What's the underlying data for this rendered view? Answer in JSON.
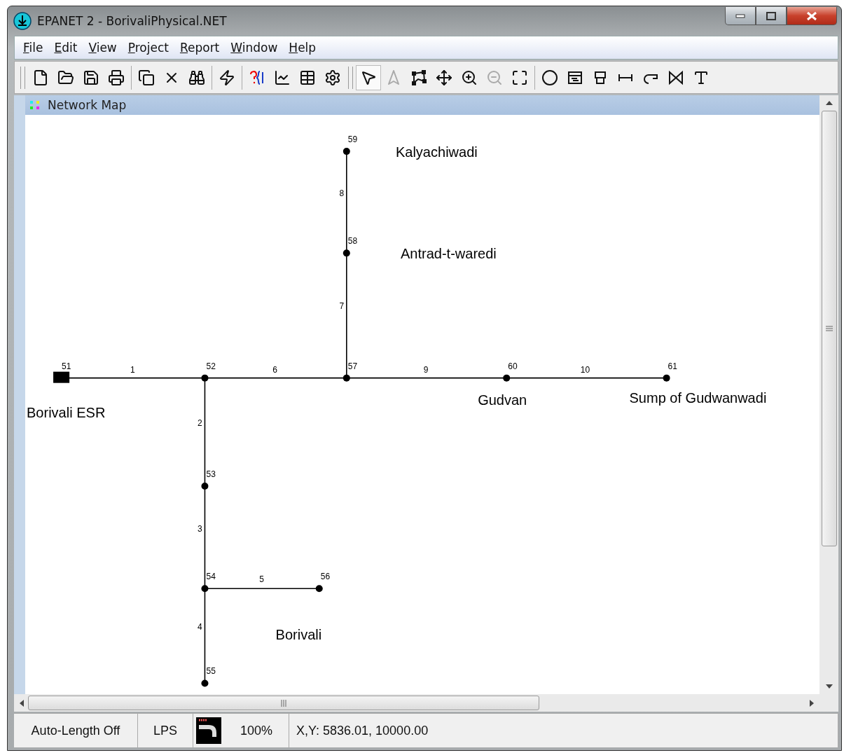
{
  "window": {
    "title": "EPANET 2 - BorivaliPhysical.NET"
  },
  "menu": [
    "File",
    "Edit",
    "View",
    "Project",
    "Report",
    "Window",
    "Help"
  ],
  "toolbar_groups": [
    [
      {
        "kind": "new",
        "selected": false,
        "disabled": false
      },
      {
        "kind": "open",
        "selected": false,
        "disabled": false
      },
      {
        "kind": "save",
        "selected": false,
        "disabled": false
      },
      {
        "kind": "print",
        "selected": false,
        "disabled": false
      }
    ],
    [
      {
        "kind": "copy",
        "selected": false,
        "disabled": false
      },
      {
        "kind": "delete",
        "selected": false,
        "disabled": false
      },
      {
        "kind": "find",
        "selected": false,
        "disabled": false
      }
    ],
    [
      {
        "kind": "run",
        "selected": false,
        "disabled": false
      }
    ],
    [
      {
        "kind": "query",
        "selected": false,
        "disabled": false
      },
      {
        "kind": "graph",
        "selected": false,
        "disabled": false
      },
      {
        "kind": "table",
        "selected": false,
        "disabled": false
      },
      {
        "kind": "options",
        "selected": false,
        "disabled": false
      }
    ],
    [
      {
        "kind": "select",
        "selected": true,
        "disabled": false
      },
      {
        "kind": "vertex",
        "selected": false,
        "disabled": true
      },
      {
        "kind": "region",
        "selected": false,
        "disabled": false
      },
      {
        "kind": "pan",
        "selected": false,
        "disabled": false
      },
      {
        "kind": "zoomin",
        "selected": false,
        "disabled": false
      },
      {
        "kind": "zoomout",
        "selected": false,
        "disabled": true
      },
      {
        "kind": "extent",
        "selected": false,
        "disabled": false
      }
    ],
    [
      {
        "kind": "junction",
        "selected": false,
        "disabled": false
      },
      {
        "kind": "reservoir",
        "selected": false,
        "disabled": false
      },
      {
        "kind": "tank",
        "selected": false,
        "disabled": false
      },
      {
        "kind": "pipe",
        "selected": false,
        "disabled": false
      },
      {
        "kind": "pump",
        "selected": false,
        "disabled": false
      },
      {
        "kind": "valve",
        "selected": false,
        "disabled": false
      },
      {
        "kind": "label",
        "selected": false,
        "disabled": false
      }
    ]
  ],
  "map_window": {
    "title": "Network Map",
    "nodes": [
      {
        "id": "59",
        "kind": "junction"
      },
      {
        "id": "58",
        "kind": "junction"
      },
      {
        "id": "51",
        "kind": "tank"
      },
      {
        "id": "52",
        "kind": "junction"
      },
      {
        "id": "57",
        "kind": "junction"
      },
      {
        "id": "60",
        "kind": "junction"
      },
      {
        "id": "61",
        "kind": "junction"
      },
      {
        "id": "53",
        "kind": "junction"
      },
      {
        "id": "54",
        "kind": "junction"
      },
      {
        "id": "56",
        "kind": "junction"
      },
      {
        "id": "55",
        "kind": "junction"
      }
    ],
    "links": [
      "8",
      "7",
      "1",
      "6",
      "9",
      "10",
      "2",
      "3",
      "5",
      "4"
    ],
    "labels": [
      "Kalyachiwadi",
      "Antrad-t-waredi",
      "Borivali ESR",
      "Gudvan",
      "Sump of Gudwanwadi",
      "Borivali"
    ]
  },
  "status_bar": {
    "auto_length": "Auto-Length Off",
    "flow_units": "LPS",
    "zoom": "100%",
    "coordinates": "X,Y: 5836.01, 10000.00"
  }
}
